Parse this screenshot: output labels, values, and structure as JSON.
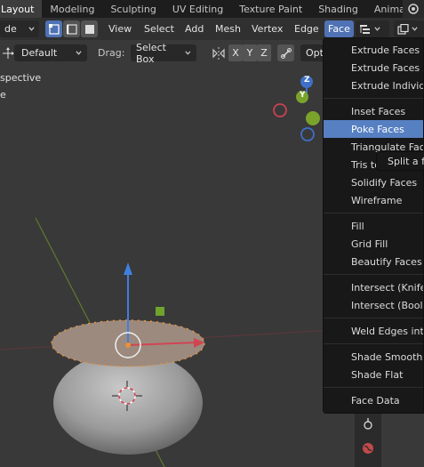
{
  "workspace_tabs": [
    "Layout",
    "Modeling",
    "Sculpting",
    "UV Editing",
    "Texture Paint",
    "Shading",
    "Animatio"
  ],
  "header": {
    "mode_label": "de",
    "menus": [
      "View",
      "Select",
      "Add",
      "Mesh",
      "Vertex",
      "Edge",
      "Face"
    ],
    "active_menu": "Face"
  },
  "tool_settings": {
    "orientation_label": "Default",
    "drag_label": "Drag:",
    "drag_value": "Select Box",
    "axes": [
      "X",
      "Y",
      "Z"
    ],
    "options_label": "Opt"
  },
  "viewport": {
    "perspective_label": "spective",
    "collection_label": "e",
    "gizmo_z_label": "Z",
    "gizmo_y_label": "Y"
  },
  "face_menu": {
    "groups": [
      [
        "Extrude Faces",
        "Extrude Faces Al",
        "Extrude Individu"
      ],
      [
        "Inset Faces",
        "Poke Faces",
        "Triangulate Face",
        "Tris to"
      ],
      [
        "Solidify Faces",
        "Wireframe"
      ],
      [
        "Fill",
        "Grid Fill",
        "Beautify Faces"
      ],
      [
        "Intersect (Knife)",
        "Intersect (Boolea"
      ],
      [
        "Weld Edges into"
      ],
      [
        "Shade Smooth",
        "Shade Flat"
      ],
      [
        "Face Data"
      ]
    ],
    "highlighted": "Poke Faces"
  },
  "tooltip": {
    "text": "Split a fa"
  },
  "colors": {
    "accent": "#4f72b4",
    "menu_highlight": "#5680c2",
    "selection_orange": "#e8923a",
    "gizmo_x": "#c94152",
    "gizmo_y": "#7aa32c",
    "gizmo_z": "#3e70c7"
  }
}
